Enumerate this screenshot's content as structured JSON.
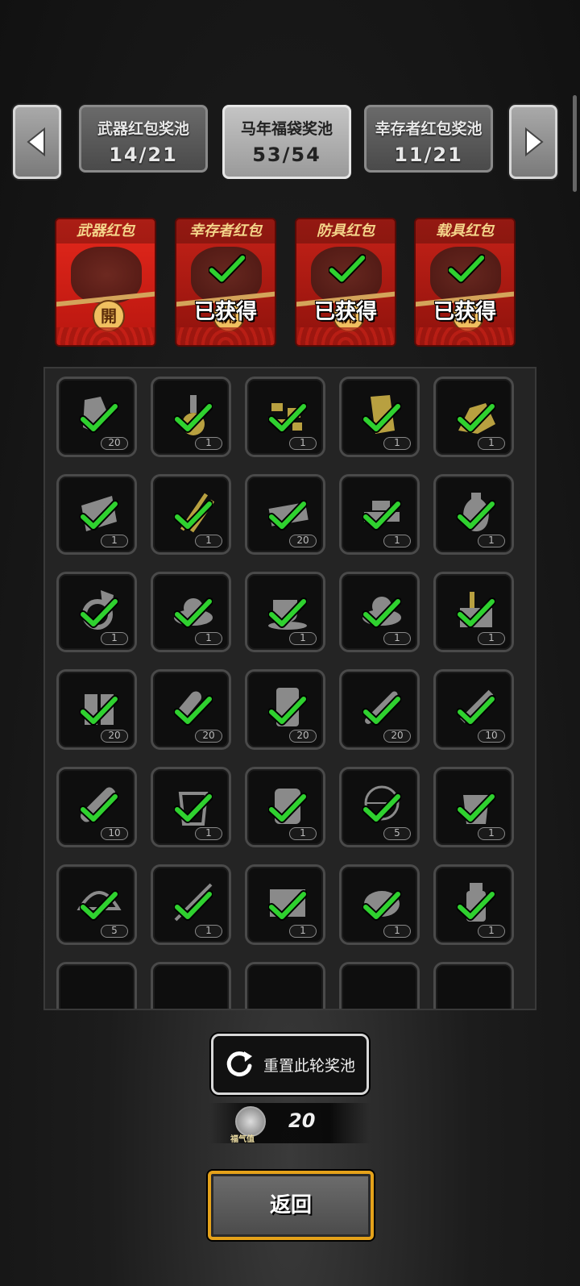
{
  "nav": {
    "prev_icon": "left-arrow-icon",
    "next_icon": "right-arrow-icon",
    "tabs": [
      {
        "name": "武器红包奖池",
        "count": "14/21",
        "active": false
      },
      {
        "name": "马年福袋奖池",
        "count": "53/54",
        "active": true
      },
      {
        "name": "幸存者红包奖池",
        "count": "11/21",
        "active": false
      }
    ]
  },
  "envelopes": [
    {
      "title": "武器红包",
      "seal": "開",
      "obtained": false,
      "obtained_label": ""
    },
    {
      "title": "幸存者红包",
      "seal": "開",
      "obtained": true,
      "obtained_label": "已获得"
    },
    {
      "title": "防具红包",
      "seal": "開",
      "obtained": true,
      "obtained_label": "已获得"
    },
    {
      "title": "载具红包",
      "seal": "開",
      "obtained": true,
      "obtained_label": "已获得"
    }
  ],
  "items": [
    {
      "icon": "fragments-icon",
      "qty": "20"
    },
    {
      "icon": "flask-icon",
      "qty": "1"
    },
    {
      "icon": "ore-chunks-icon",
      "qty": "1"
    },
    {
      "icon": "wood-planks-icon",
      "qty": "1"
    },
    {
      "icon": "gold-pile-icon",
      "qty": "1"
    },
    {
      "icon": "cloth-icon",
      "qty": "1"
    },
    {
      "icon": "knives-icon",
      "qty": "1"
    },
    {
      "icon": "cash-stack-icon",
      "qty": "20"
    },
    {
      "icon": "gold-bars-icon",
      "qty": "1"
    },
    {
      "icon": "vase-icon",
      "qty": "1"
    },
    {
      "icon": "diamond-ring-icon",
      "qty": "1"
    },
    {
      "icon": "food-bowl-icon",
      "qty": "1"
    },
    {
      "icon": "coffee-cup-icon",
      "qty": "1"
    },
    {
      "icon": "food-plate-icon",
      "qty": "1"
    },
    {
      "icon": "toolbox-icon",
      "qty": "1"
    },
    {
      "icon": "battery-icon",
      "qty": "20"
    },
    {
      "icon": "bullet-icon",
      "qty": "20"
    },
    {
      "icon": "fuel-barrel-icon",
      "qty": "20"
    },
    {
      "icon": "rifle-round-icon",
      "qty": "20"
    },
    {
      "icon": "syringe-icon",
      "qty": "10"
    },
    {
      "icon": "shell-icon",
      "qty": "10"
    },
    {
      "icon": "drink-cup-icon",
      "qty": "1"
    },
    {
      "icon": "jar-icon",
      "qty": "1"
    },
    {
      "icon": "net-trap-icon",
      "qty": "5"
    },
    {
      "icon": "juice-icon",
      "qty": "1"
    },
    {
      "icon": "helmet-net-icon",
      "qty": "5"
    },
    {
      "icon": "wire-icon",
      "qty": "1"
    },
    {
      "icon": "blankets-icon",
      "qty": "1"
    },
    {
      "icon": "bread-icon",
      "qty": "1"
    },
    {
      "icon": "medicine-bottle-icon",
      "qty": "1"
    }
  ],
  "reset": {
    "label": "重置此轮奖池",
    "icon": "refresh-icon"
  },
  "fortune": {
    "icon": "fortune-coin-icon",
    "label": "福气值",
    "value": "20"
  },
  "back": {
    "label": "返回"
  },
  "colors": {
    "check": "#2fd12f",
    "envelope_red": "#c62218",
    "gold_border": "#e5a21a"
  }
}
